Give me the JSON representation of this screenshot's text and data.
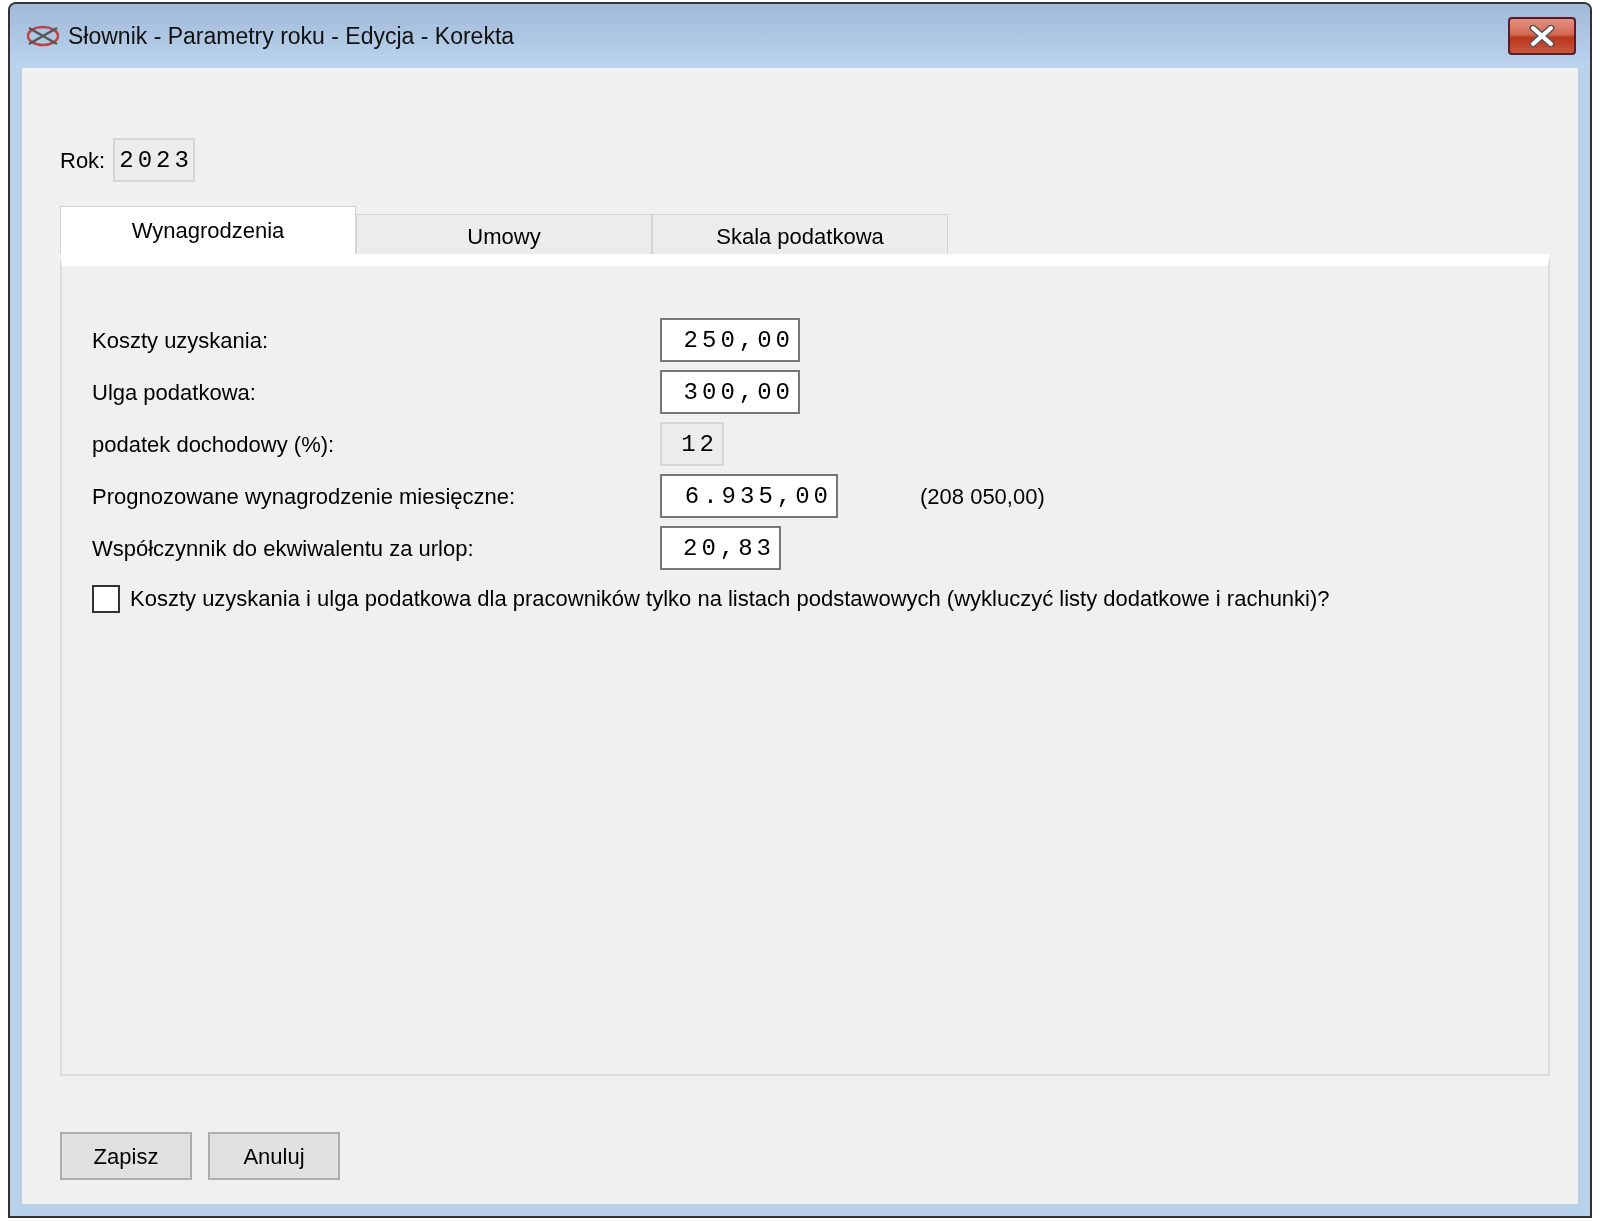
{
  "window": {
    "title": "Słownik - Parametry roku - Edycja - Korekta"
  },
  "year": {
    "label": "Rok:",
    "value": "2023",
    "readonly": true
  },
  "tabs": [
    {
      "label": "Wynagrodzenia",
      "selected": true
    },
    {
      "label": "Umowy",
      "selected": false
    },
    {
      "label": "Skala podatkowa",
      "selected": false
    }
  ],
  "fields": [
    {
      "label": "Koszty uzyskania:",
      "value": "250,00",
      "readonly": false
    },
    {
      "label": "Ulga podatkowa:",
      "value": "300,00",
      "readonly": false
    },
    {
      "label": "podatek dochodowy (%):",
      "value": "12",
      "readonly": true
    },
    {
      "label": "Prognozowane wynagrodzenie miesięczne:",
      "value": "6.935,00",
      "readonly": false,
      "note": "(208 050,00)"
    },
    {
      "label": "Współczynnik do ekwiwalentu za urlop:",
      "value": "20,83",
      "readonly": false
    }
  ],
  "checkbox": {
    "label": "Koszty uzyskania i ulga podatkowa dla pracowników tylko na listach podstawowych (wykluczyć listy dodatkowe i rachunki)?",
    "checked": false
  },
  "buttons": [
    "Zapisz",
    "Anuluj"
  ]
}
